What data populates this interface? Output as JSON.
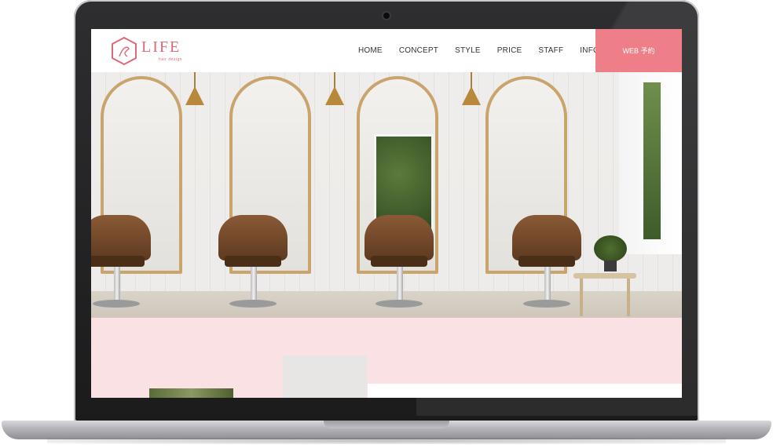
{
  "site": {
    "logo_title": "LIFE",
    "logo_subtitle": "hair design",
    "logo_icon": "hexagon-monogram-icon"
  },
  "nav": {
    "items": [
      {
        "label": "HOME"
      },
      {
        "label": "CONCEPT"
      },
      {
        "label": "STYLE"
      },
      {
        "label": "PRICE"
      },
      {
        "label": "STAFF"
      },
      {
        "label": "INFO"
      }
    ],
    "reserve_label": "WEB 予約"
  },
  "colors": {
    "accent": "#ee7f88",
    "logo": "#d96b79",
    "pink_band": "#fae1e4",
    "mirror_frame": "#c9a46c"
  }
}
